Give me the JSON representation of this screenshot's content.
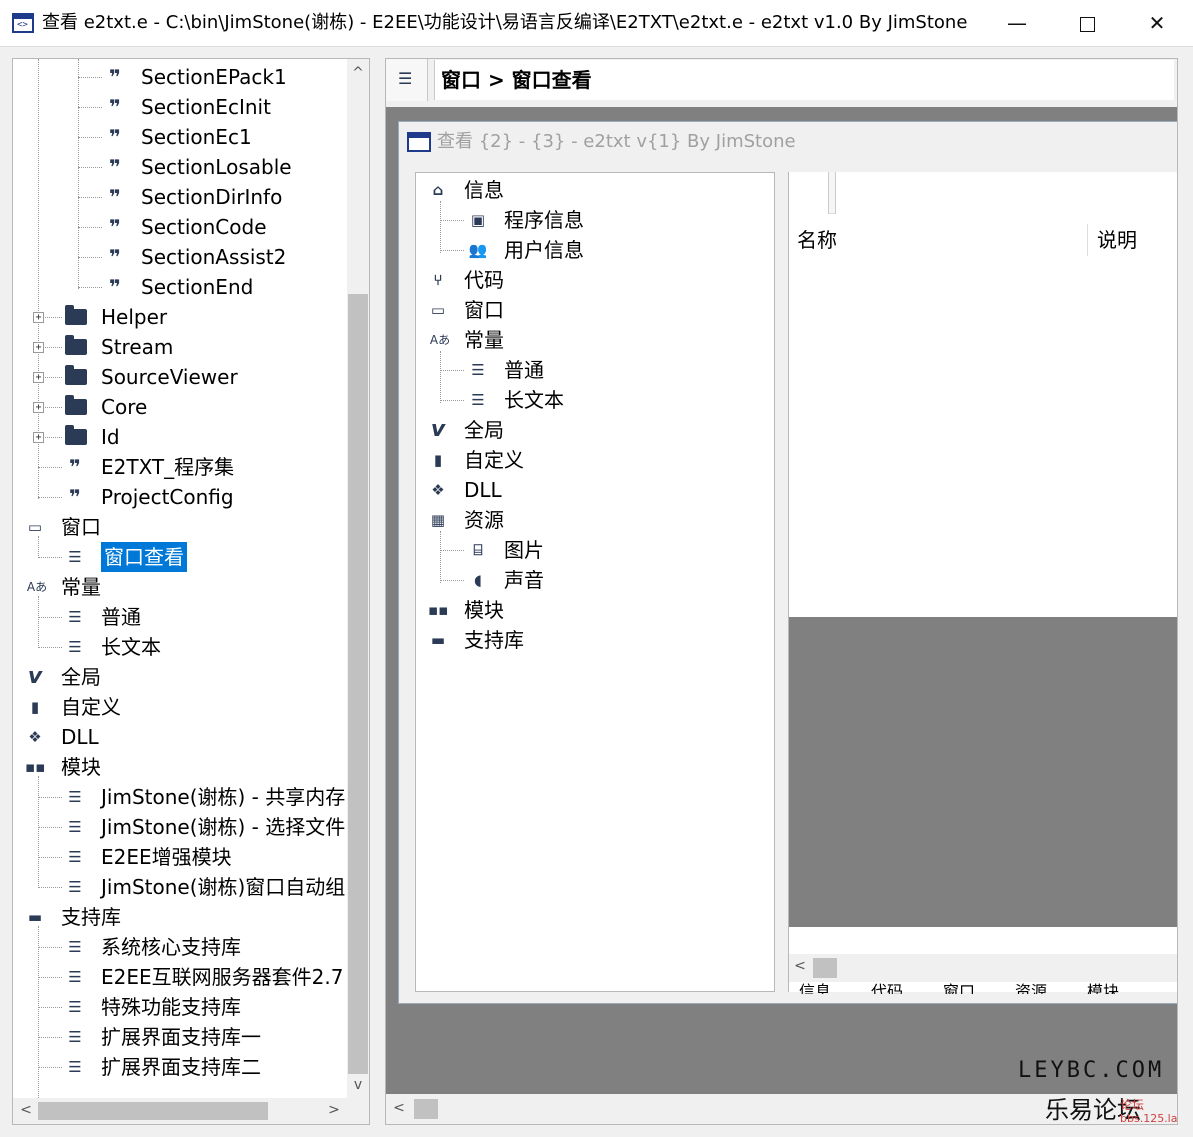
{
  "window": {
    "title": "查看 e2txt.e - C:\\bin\\JimStone(谢栋) - E2EE\\功能设计\\易语言反编译\\E2TXT\\e2txt.e - e2txt v1.0 By JimStone",
    "minimize": "—",
    "close": "✕"
  },
  "left_tree": {
    "items": [
      {
        "label": "SectionEPack1",
        "icon": "quote-icon"
      },
      {
        "label": "SectionEcInit",
        "icon": "quote-icon"
      },
      {
        "label": "SectionEc1",
        "icon": "quote-icon"
      },
      {
        "label": "SectionLosable",
        "icon": "quote-icon"
      },
      {
        "label": "SectionDirInfo",
        "icon": "quote-icon"
      },
      {
        "label": "SectionCode",
        "icon": "quote-icon"
      },
      {
        "label": "SectionAssist2",
        "icon": "quote-icon"
      },
      {
        "label": "SectionEnd",
        "icon": "quote-icon"
      },
      {
        "label": "Helper",
        "icon": "folder-icon"
      },
      {
        "label": "Stream",
        "icon": "folder-icon"
      },
      {
        "label": "SourceViewer",
        "icon": "folder-icon"
      },
      {
        "label": "Core",
        "icon": "folder-icon"
      },
      {
        "label": "Id",
        "icon": "folder-icon"
      },
      {
        "label": "E2TXT_程序集",
        "icon": "quote-icon"
      },
      {
        "label": "ProjectConfig",
        "icon": "quote-icon"
      },
      {
        "label": "窗口",
        "icon": "window-icon"
      },
      {
        "label": "窗口查看",
        "icon": "list-icon"
      },
      {
        "label": "常量",
        "icon": "text-icon"
      },
      {
        "label": "普通",
        "icon": "list-icon"
      },
      {
        "label": "长文本",
        "icon": "list-icon"
      },
      {
        "label": "全局",
        "icon": "v-icon"
      },
      {
        "label": "自定义",
        "icon": "book-icon"
      },
      {
        "label": "DLL",
        "icon": "dropbox-icon"
      },
      {
        "label": "模块",
        "icon": "grid-icon"
      },
      {
        "label": "JimStone(谢栋) - 共享内存",
        "icon": "list-icon"
      },
      {
        "label": "JimStone(谢栋) - 选择文件",
        "icon": "list-icon"
      },
      {
        "label": "E2EE增强模块",
        "icon": "list-icon"
      },
      {
        "label": "JimStone(谢栋)窗口自动组",
        "icon": "list-icon"
      },
      {
        "label": "支持库",
        "icon": "lib-icon"
      },
      {
        "label": "系统核心支持库",
        "icon": "list-icon"
      },
      {
        "label": "E2EE互联网服务器套件2.7",
        "icon": "list-icon"
      },
      {
        "label": "特殊功能支持库",
        "icon": "list-icon"
      },
      {
        "label": "扩展界面支持库一",
        "icon": "list-icon"
      },
      {
        "label": "扩展界面支持库二",
        "icon": "list-icon"
      }
    ]
  },
  "right": {
    "breadcrumb": "窗口 > 窗口查看",
    "child_window": {
      "title": "查看 {2} - {3} - e2txt v{1} By JimStone",
      "tree": [
        {
          "label": "信息",
          "icon": "home-icon"
        },
        {
          "label": "程序信息",
          "icon": "card-icon"
        },
        {
          "label": "用户信息",
          "icon": "users-icon"
        },
        {
          "label": "代码",
          "icon": "branch-icon"
        },
        {
          "label": "窗口",
          "icon": "window-icon"
        },
        {
          "label": "常量",
          "icon": "text-icon"
        },
        {
          "label": "普通",
          "icon": "list-icon"
        },
        {
          "label": "长文本",
          "icon": "list-icon"
        },
        {
          "label": "全局",
          "icon": "v-icon"
        },
        {
          "label": "自定义",
          "icon": "book-icon"
        },
        {
          "label": "DLL",
          "icon": "dropbox-icon"
        },
        {
          "label": "资源",
          "icon": "briefcase-icon"
        },
        {
          "label": "图片",
          "icon": "image-icon"
        },
        {
          "label": "声音",
          "icon": "sound-icon"
        },
        {
          "label": "模块",
          "icon": "grid-icon"
        },
        {
          "label": "支持库",
          "icon": "lib-icon"
        }
      ],
      "list_columns": [
        "名称",
        "说明"
      ],
      "tabs": [
        "信息",
        "代码",
        "窗口",
        "资源",
        "模块"
      ]
    }
  },
  "watermark": {
    "line1": "LEYBC.COM",
    "line2": "乐易论坛",
    "line3": "论坛",
    "line4": "bbs.125.la"
  },
  "icons": {
    "quote": "❞",
    "list": "☰",
    "window": "▭",
    "text": "Aあ",
    "v": "v",
    "book": "▮",
    "dropbox": "❖",
    "grid": "▪▪",
    "lib": "▬"
  },
  "colors": {
    "selection": "#0078d7",
    "mdi_bg": "#808080"
  }
}
